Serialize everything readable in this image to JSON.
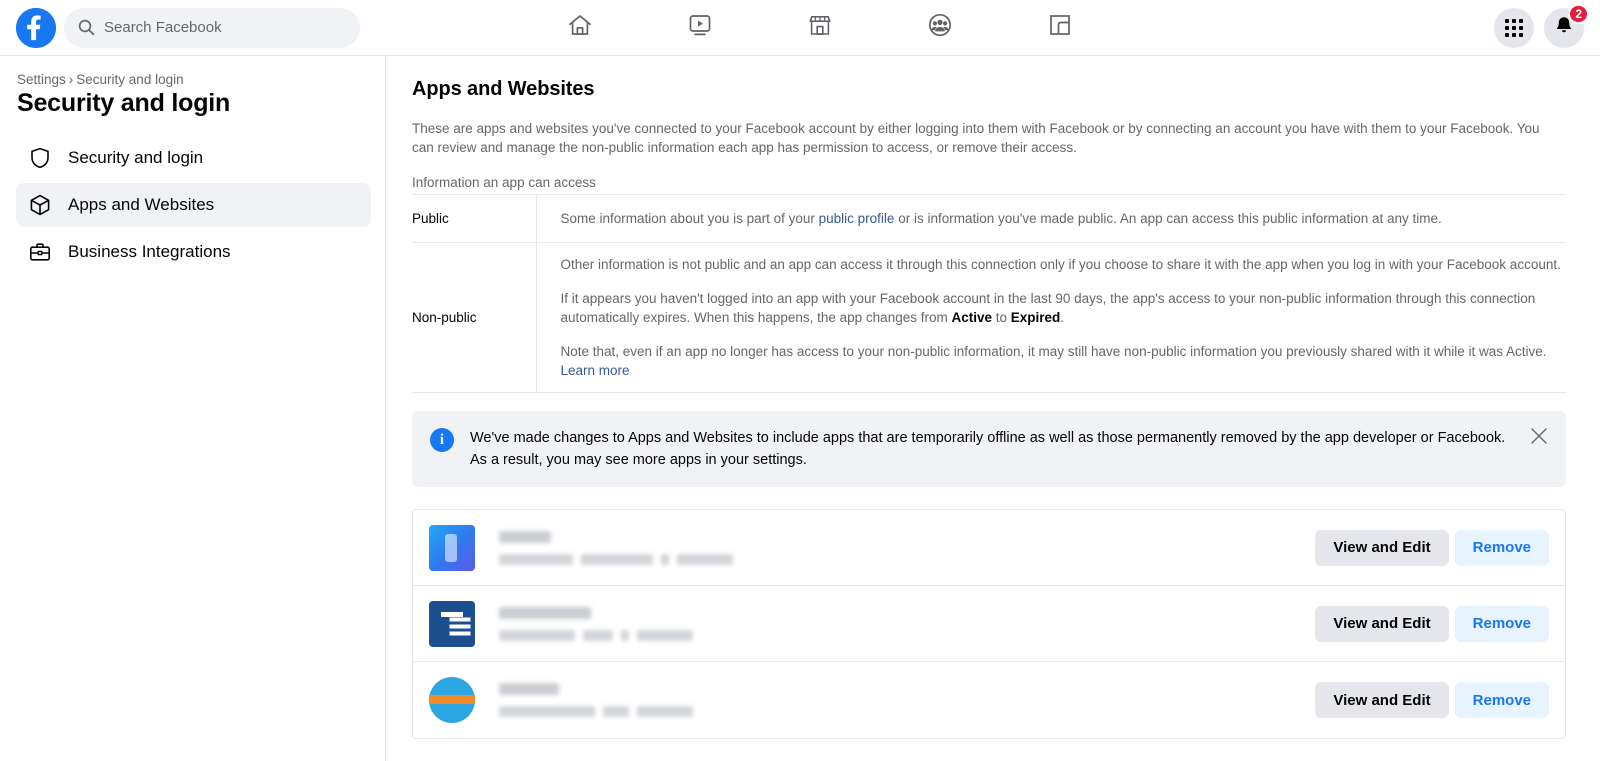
{
  "topbar": {
    "logo_icon": "facebook-logo-icon",
    "search": {
      "placeholder": "Search Facebook",
      "value": "",
      "icon": "search-icon"
    },
    "nav": [
      {
        "name": "home",
        "icon": "home-icon"
      },
      {
        "name": "watch",
        "icon": "video-play-icon"
      },
      {
        "name": "marketplace",
        "icon": "storefront-icon"
      },
      {
        "name": "groups",
        "icon": "groups-icon"
      },
      {
        "name": "gaming",
        "icon": "gaming-icon"
      }
    ],
    "menu_icon": "grid-menu-icon",
    "notifications_icon": "bell-icon",
    "notifications_count": "2"
  },
  "sidebar": {
    "breadcrumb": {
      "root": "Settings",
      "separator": "›",
      "current": "Security and login"
    },
    "title": "Security and login",
    "items": [
      {
        "label": "Security and login",
        "icon": "shield-icon",
        "active": false
      },
      {
        "label": "Apps and Websites",
        "icon": "cube-icon",
        "active": true
      },
      {
        "label": "Business Integrations",
        "icon": "briefcase-icon",
        "active": false
      }
    ]
  },
  "main": {
    "title": "Apps and Websites",
    "intro": "These are apps and websites you've connected to your Facebook account by either logging into them with Facebook or by connecting an account you have with them to your Facebook. You can review and manage the non-public information each app has permission to access, or remove their access.",
    "subhead": "Information an app can access",
    "info_rows": [
      {
        "label": "Public",
        "paragraphs": [
          {
            "parts": [
              {
                "text": "Some information about you is part of your ",
                "style": "normal"
              },
              {
                "text": "public profile",
                "style": "link"
              },
              {
                "text": " or is information you've made public. An app can access this public information at any time.",
                "style": "normal"
              }
            ]
          }
        ]
      },
      {
        "label": "Non-public",
        "paragraphs": [
          {
            "parts": [
              {
                "text": "Other information is not public and an app can access it through this connection only if you choose to share it with the app when you log in with your Facebook account.",
                "style": "normal"
              }
            ]
          },
          {
            "parts": [
              {
                "text": "If it appears you haven't logged into an app with your Facebook account in the last 90 days, the app's access to your non-public information through this connection automatically expires. When this happens, the app changes from ",
                "style": "normal"
              },
              {
                "text": "Active",
                "style": "bold"
              },
              {
                "text": " to ",
                "style": "normal"
              },
              {
                "text": "Expired",
                "style": "bold"
              },
              {
                "text": ".",
                "style": "normal"
              }
            ]
          },
          {
            "parts": [
              {
                "text": "Note that, even if an app no longer has access to your non-public information, it may still have non-public information you previously shared with it while it was Active. ",
                "style": "normal"
              },
              {
                "text": "Learn more",
                "style": "link"
              }
            ]
          }
        ]
      }
    ],
    "banner": {
      "icon": "info-circle-icon",
      "glyph": "i",
      "text": "We've made changes to Apps and Websites to include apps that are temporarily offline as well as those permanently removed by the app developer or Facebook. As a result, you may see more apps in your settings.",
      "close_icon": "close-icon"
    },
    "apps": {
      "view_edit_label": "View and Edit",
      "remove_label": "Remove",
      "rows": [
        {
          "icon_style": "grad1",
          "name_redacted": true,
          "meta_redacted": true,
          "status_chip": "redacted-green-status"
        },
        {
          "icon_style": "tmark",
          "name_redacted": true,
          "meta_redacted": true,
          "status_chip": "redacted-green-status"
        },
        {
          "icon_style": "globe",
          "name_redacted": true,
          "meta_redacted": true,
          "status_chip": "redacted-green-status"
        }
      ]
    }
  },
  "colors": {
    "brand_blue": "#1877f2",
    "link_blue": "#385898",
    "badge_red": "#e41e3f",
    "surface_gray": "#f0f2f5",
    "button_gray": "#e4e6eb",
    "button_light_blue": "#e7f3ff"
  }
}
